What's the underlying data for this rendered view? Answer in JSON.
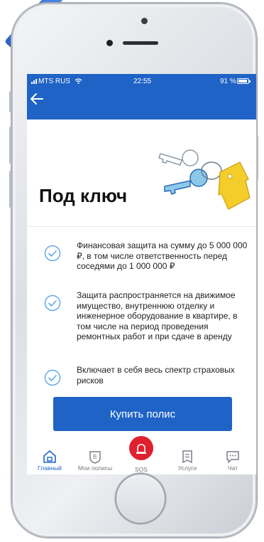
{
  "status_bar": {
    "carrier": "MTS RUS",
    "time": "22:55",
    "battery": "91 %"
  },
  "header": {
    "back_icon": "arrow-left-icon"
  },
  "product": {
    "title": "Под ключ",
    "features": [
      {
        "icon": "check-circle-icon",
        "text": "Финансовая защита на сумму до 5 000 000 ₽, в том числе ответственность перед соседями до 1 000 000 ₽"
      },
      {
        "icon": "check-circle-icon",
        "text": "Защита распространяется на движимое имущество, внутреннюю отделку и инженерное оборудование в квартире, в том числе на период проведения ремонтных работ и при сдаче в аренду"
      },
      {
        "icon": "check-circle-icon",
        "text": "Включает в себя весь спектр страховых рисков"
      }
    ],
    "buy_button": "Купить полис"
  },
  "tabbar": {
    "tabs": [
      {
        "label": "Главный",
        "icon": "home-icon",
        "active": true
      },
      {
        "label": "Мои полисы",
        "icon": "policy-shield-icon",
        "active": false
      },
      {
        "label": "SOS",
        "icon": "alarm-siren-icon",
        "active": false
      },
      {
        "label": "Услуги",
        "icon": "services-list-icon",
        "active": false
      },
      {
        "label": "Чат",
        "icon": "chat-bubble-icon",
        "active": false
      }
    ]
  },
  "colors": {
    "brand_blue": "#1f63c7",
    "sos_red": "#e0202e",
    "check_blue": "#5aa6e6",
    "house_yellow": "#f5cd2a"
  }
}
